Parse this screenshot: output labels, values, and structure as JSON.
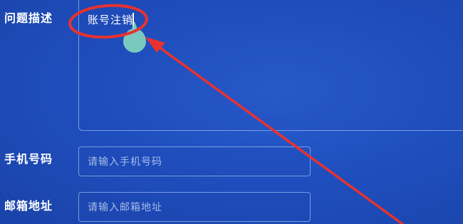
{
  "form": {
    "description": {
      "label": "问题描述",
      "value": "账号注销"
    },
    "phone": {
      "label": "手机号码",
      "placeholder": "请输入手机号码"
    },
    "email": {
      "label": "邮箱地址",
      "placeholder": "请输入邮箱地址"
    }
  },
  "colors": {
    "background": "#1f4fbf",
    "annotation": "#e8322f",
    "handle": "#7fd0c0"
  }
}
